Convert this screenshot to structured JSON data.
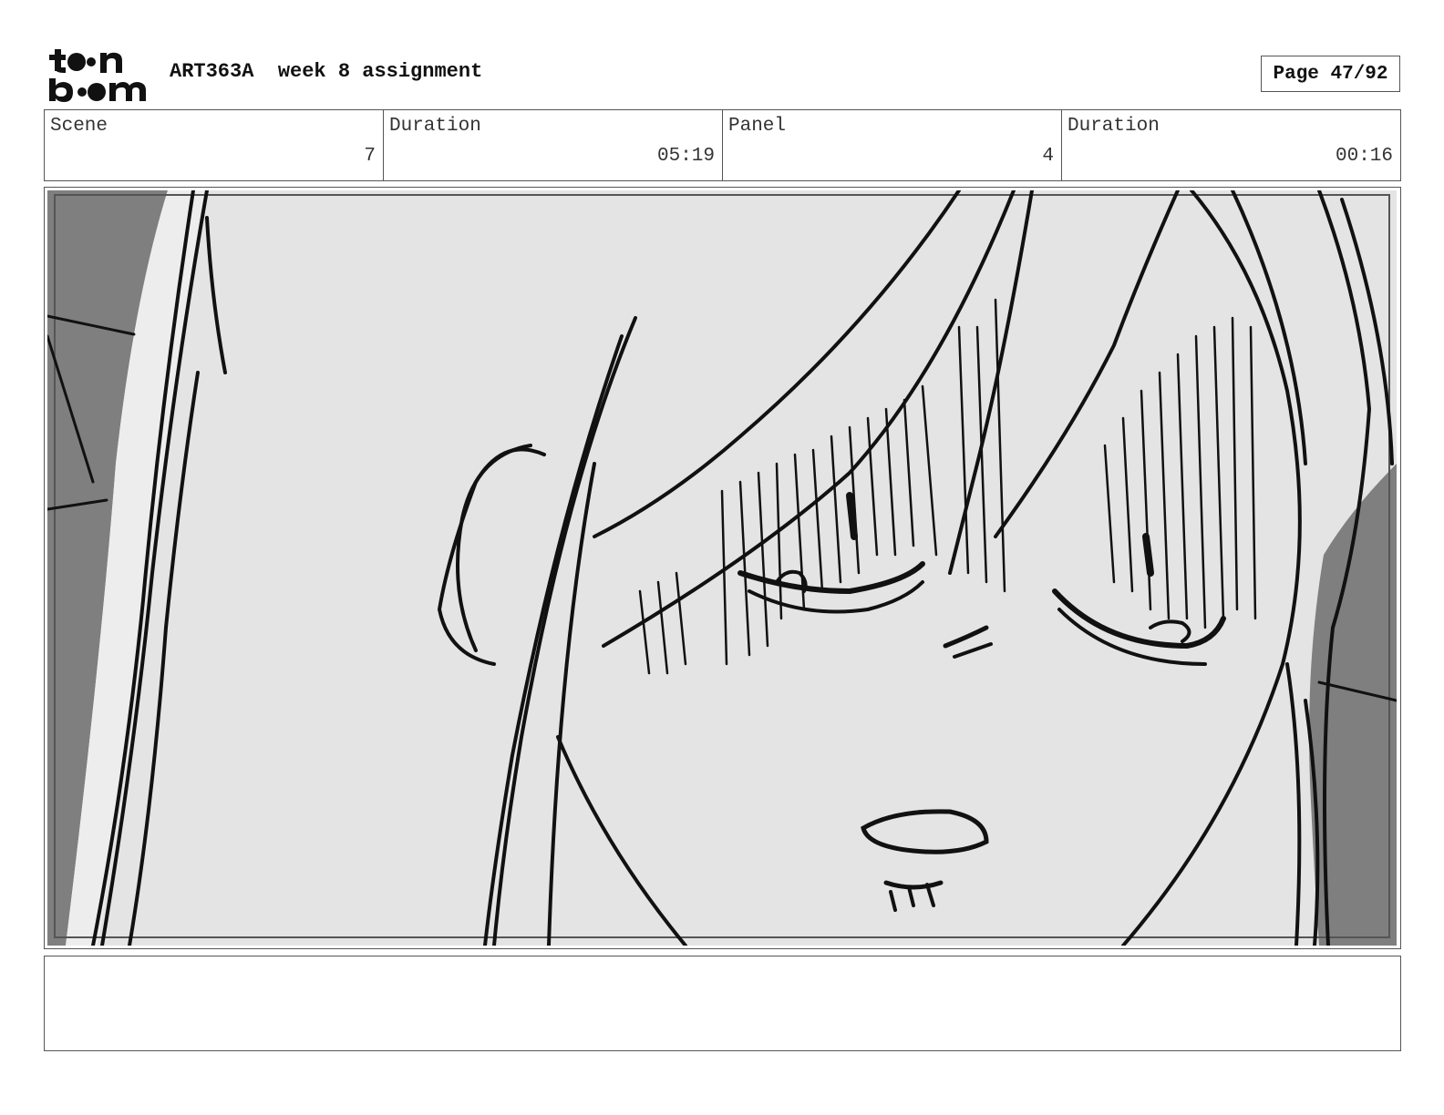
{
  "header": {
    "logo_alt": "toon boom",
    "project": "ART363A",
    "assignment": "week 8 assignment",
    "page_label": "Page 47/92"
  },
  "info": {
    "scene_label": "Scene",
    "scene_value": "7",
    "scene_duration_label": "Duration",
    "scene_duration_value": "05:19",
    "panel_label": "Panel",
    "panel_value": "4",
    "panel_duration_label": "Duration",
    "panel_duration_value": "00:16"
  },
  "panel": {
    "image_description": "rough storyboard sketch of a girl's face close-up with sad eyes, ear, long hair",
    "background_gray": "#e4e4e4",
    "shadow_gray": "#7f7f7f"
  },
  "notes": {
    "text": ""
  }
}
